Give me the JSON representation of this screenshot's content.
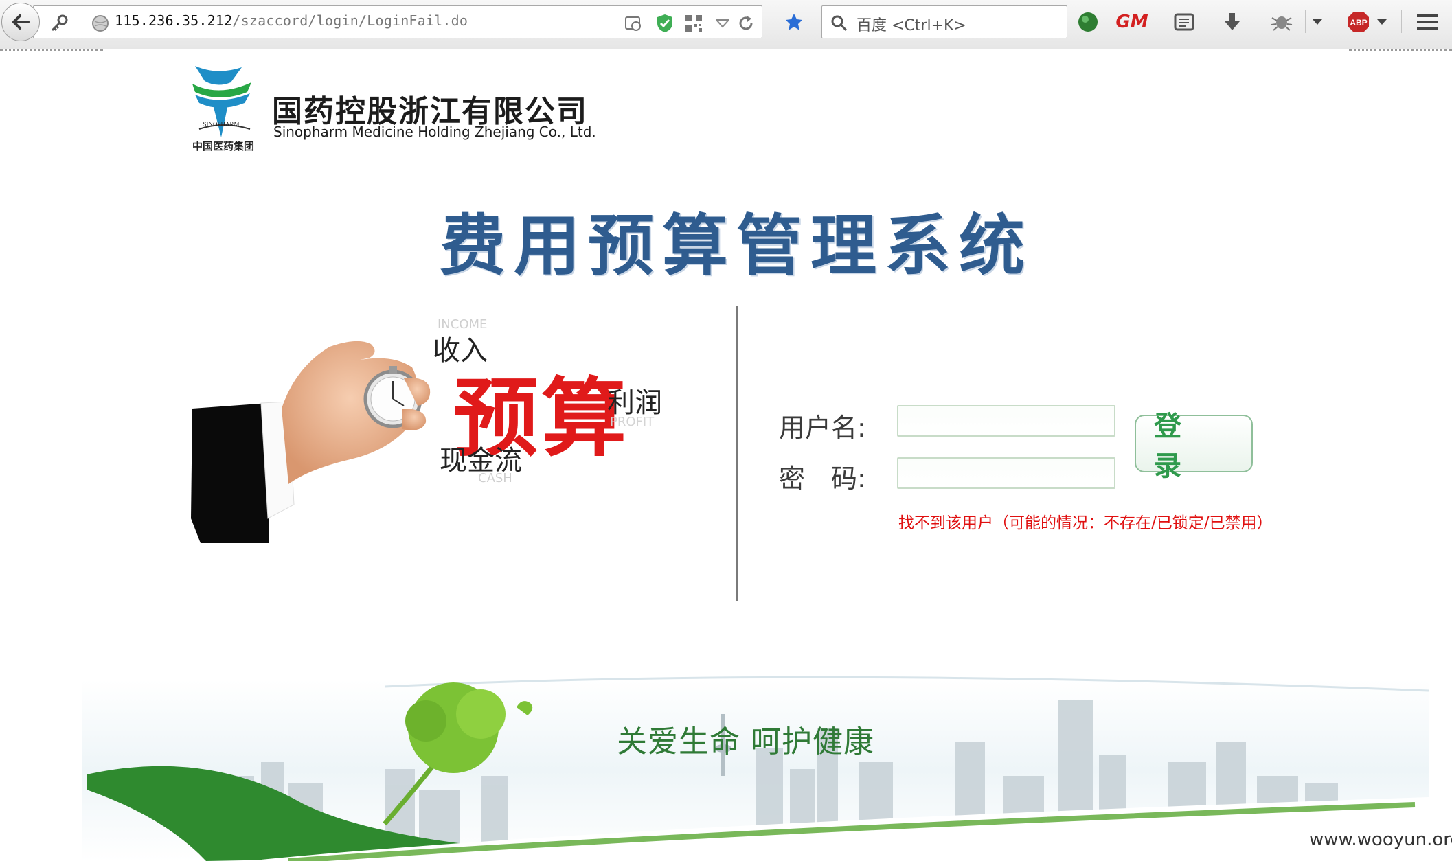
{
  "browser": {
    "url_host": "115.236.35.212",
    "url_path": "/szaccord/login/LoginFail.do",
    "search_placeholder": "百度 <Ctrl+K>",
    "icons": [
      "back-arrow-icon",
      "key-icon",
      "globe-icon",
      "page-icon",
      "shield-icon",
      "qr-code-icon",
      "dropdown-icon",
      "reload-icon",
      "bookmark-icon",
      "search-icon",
      "green-orb-icon",
      "gm-icon",
      "reader-icon",
      "download-icon",
      "bug-icon",
      "menu-dropdown-icon",
      "adblock-plus-icon",
      "hamburger-menu-icon"
    ],
    "abp_label": "ABP",
    "gm_label": "GM"
  },
  "header": {
    "company_name_cn": "国药控股浙江有限公司",
    "company_name_en": "Sinopharm Medicine Holding Zhejiang  Co., Ltd.",
    "logo_caption": "中国医药集团",
    "logo_ring_text": "SINOPHARM",
    "system_title": "费用预算管理系统"
  },
  "illustration": {
    "income_en": "INCOME",
    "income": "收入",
    "budget": "预算",
    "profit": "利润",
    "profit_en": "PROFIT",
    "cash": "现金流",
    "cash_en": "CASH"
  },
  "login_form": {
    "username_label": "用户名:",
    "username_value": "",
    "password_label": "密　码:",
    "password_value": "",
    "login_button": "登 录",
    "error_message": "找不到该用户（可能的情况：不存在/已锁定/已禁用）"
  },
  "footer": {
    "slogan": "关爱生命  呵护健康",
    "watermark": "www.wooyun.org"
  },
  "colors": {
    "title_blue": "#2f5c8f",
    "budget_red": "#e01a1a",
    "error_red": "#e01010",
    "brand_green": "#2f9a4c"
  }
}
